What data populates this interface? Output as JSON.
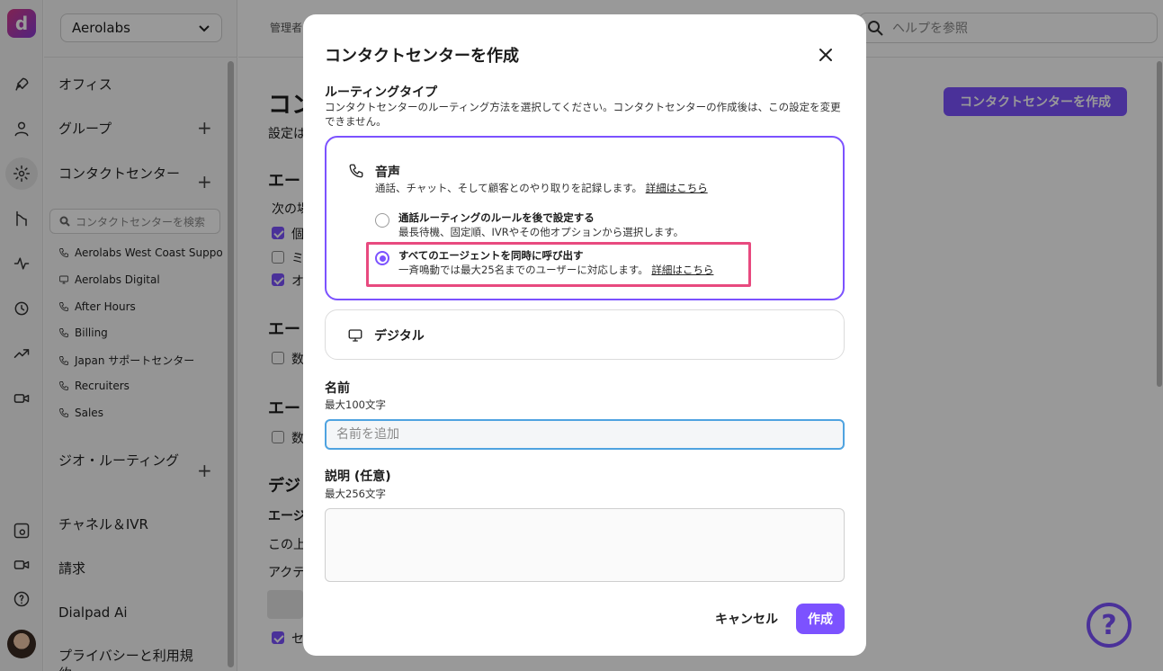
{
  "app": {
    "org_name": "Aerolabs",
    "admin_label": "管理者",
    "help_placeholder": "ヘルプを参照"
  },
  "sidebar": {
    "items": [
      {
        "label": "オフィス"
      },
      {
        "label": "グループ"
      },
      {
        "label": "コンタクトセンター"
      },
      {
        "label": "ジオ・ルーティング"
      },
      {
        "label": "チャネル＆IVR"
      },
      {
        "label": "請求"
      },
      {
        "label": "Dialpad Ai"
      },
      {
        "label": "プライバシーと利用規約"
      }
    ],
    "search_placeholder": "コンタクトセンターを検索",
    "contact_centers": [
      {
        "label": "Aerolabs West Coast Support",
        "icon": "phone-icon"
      },
      {
        "label": "Aerolabs Digital",
        "icon": "monitor-icon"
      },
      {
        "label": "After Hours",
        "icon": "phone-icon"
      },
      {
        "label": "Billing",
        "icon": "phone-icon"
      },
      {
        "label": "Japan サポートセンター",
        "icon": "phone-icon"
      },
      {
        "label": "Recruiters",
        "icon": "phone-icon"
      },
      {
        "label": "Sales",
        "icon": "phone-icon"
      }
    ]
  },
  "main": {
    "title": "コン",
    "subtitle": "設定は",
    "create_button": "コンタクトセンターを作成",
    "h1": "エー",
    "line1": "次の場",
    "cb1": "個",
    "cb2": "ミ",
    "cb3": "オ",
    "h2": "エー",
    "cb4": "数",
    "h3": "エー",
    "cb5": "数",
    "h4": "デジ",
    "h5": "エージ",
    "line2": "この上",
    "line3": "アクテ",
    "cb6": "セ"
  },
  "modal": {
    "title": "コンタクトセンターを作成",
    "routing_label": "ルーティングタイプ",
    "routing_help": "コンタクトセンターのルーティング方法を選択してください。コンタクトセンターの作成後は、この設定を変更できません。",
    "voice": {
      "title": "音声",
      "desc": "通話、チャット、そして顧客とのやり取りを記録します。",
      "link": "詳細はこちら",
      "options": [
        {
          "title": "通話ルーティングのルールを後で設定する",
          "desc": "最長待機、固定順、IVRやその他オプションから選択します。",
          "selected": false
        },
        {
          "title": "すべてのエージェントを同時に呼び出す",
          "desc": "一斉鳴動では最大25名までのユーザーに対応します。",
          "link": "詳細はこちら",
          "selected": true
        }
      ]
    },
    "digital": {
      "title": "デジタル"
    },
    "name_label": "名前",
    "name_help": "最大100文字",
    "name_placeholder": "名前を追加",
    "desc_label": "説明 (任意)",
    "desc_help": "最大256文字",
    "cancel": "キャンセル",
    "create": "作成"
  },
  "colors": {
    "accent": "#7c52ff",
    "highlight": "#e84a7f",
    "focus": "#4fa3e0"
  }
}
